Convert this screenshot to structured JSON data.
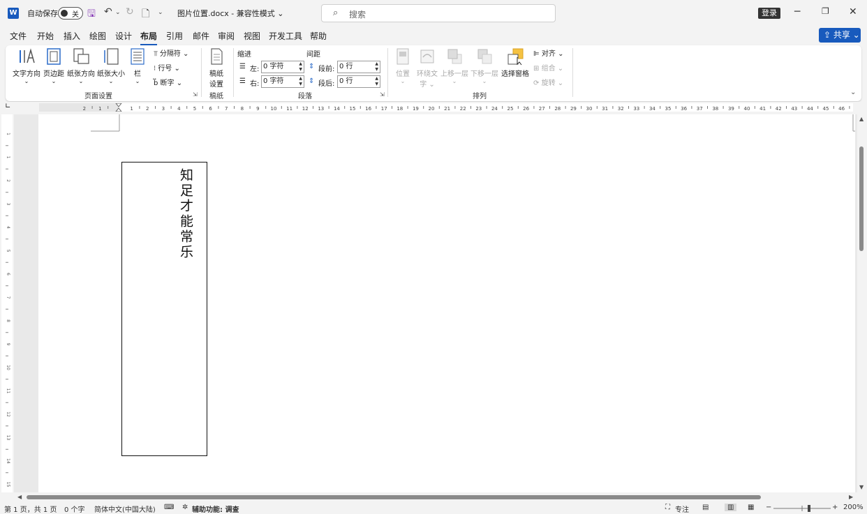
{
  "titlebar": {
    "app_icon": "word-logo",
    "autosave_label": "自动保存",
    "autosave_state": "关",
    "doc_title": "图片位置.docx  -  兼容性模式 ⌄",
    "search_placeholder": "搜索",
    "login_label": "登录"
  },
  "tabs": [
    {
      "label": "文件"
    },
    {
      "label": "开始"
    },
    {
      "label": "插入"
    },
    {
      "label": "绘图"
    },
    {
      "label": "设计"
    },
    {
      "label": "布局"
    },
    {
      "label": "引用"
    },
    {
      "label": "邮件"
    },
    {
      "label": "审阅"
    },
    {
      "label": "视图"
    },
    {
      "label": "开发工具"
    },
    {
      "label": "帮助"
    }
  ],
  "share_label": "⇪ 共享 ⌄",
  "ribbon": {
    "page_setup": {
      "text_direction": "文字方向",
      "margins": "页边距",
      "orientation": "纸张方向",
      "size": "纸张大小",
      "columns": "栏",
      "breaks": "分隔符 ⌄",
      "line_numbers": "行号 ⌄",
      "hyphenation": "断字 ⌄",
      "group_label": "页面设置"
    },
    "manuscript": {
      "button": "稿纸设置",
      "button_line1": "稿纸",
      "button_line2": "设置",
      "group_label": "稿纸"
    },
    "paragraph": {
      "indent_header": "缩进",
      "spacing_header": "间距",
      "left_label": "左:",
      "left_value": "0 字符",
      "right_label": "右:",
      "right_value": "0 字符",
      "before_label": "段前:",
      "before_value": "0 行",
      "after_label": "段后:",
      "after_value": "0 行",
      "group_label": "段落"
    },
    "arrange": {
      "position": "位置",
      "wrap_text_line1": "环绕文",
      "wrap_text_line2": "字 ⌄",
      "bring_forward": "上移一层",
      "send_backward": "下移一层",
      "selection_pane": "选择窗格",
      "align": "对齐 ⌄",
      "group": "组合 ⌄",
      "rotate": "旋转 ⌄",
      "group_label": "排列"
    }
  },
  "ruler": {
    "numbers": [
      "2",
      "1",
      "1",
      "2",
      "3",
      "4",
      "5",
      "6",
      "7",
      "8",
      "9",
      "10",
      "11",
      "12",
      "13",
      "14",
      "15",
      "16",
      "17",
      "18",
      "19",
      "20",
      "21",
      "22",
      "23",
      "24",
      "25",
      "26",
      "27",
      "28",
      "29",
      "30",
      "31",
      "32",
      "33",
      "34",
      "35",
      "36",
      "37",
      "38",
      "39",
      "40",
      "41",
      "42",
      "43",
      "44",
      "45",
      "46"
    ]
  },
  "vruler": {
    "numbers": [
      "1",
      "1",
      "2",
      "3",
      "4",
      "5",
      "6",
      "7",
      "8",
      "9",
      "10",
      "11",
      "12",
      "13",
      "14",
      "15",
      "16"
    ]
  },
  "document": {
    "textbox_text": "知足才能常乐"
  },
  "statusbar": {
    "page_info": "第 1 页，共 1 页",
    "word_count": "0 个字",
    "language": "简体中文(中国大陆)",
    "accessibility": "辅助功能: 调查",
    "focus": "专注",
    "zoom_level": "200%",
    "zoom_fraction": 0.5
  },
  "colors": {
    "accent": "#185abd",
    "ribbon_bg": "#ffffff",
    "window_bg": "#f3f3f3",
    "selection_pane_icon": "#f5c242"
  }
}
